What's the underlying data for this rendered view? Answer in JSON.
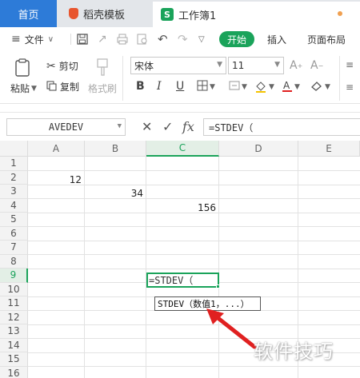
{
  "tabs": {
    "home": "首页",
    "daoke": "稻壳模板",
    "workbook": "工作簿1"
  },
  "menu": {
    "file": "文件",
    "start": "开始",
    "insert": "插入",
    "page_layout": "页面布局"
  },
  "ribbon": {
    "paste": "粘贴",
    "cut": "剪切",
    "copy": "复制",
    "format_painter": "格式刷",
    "font_name": "宋体",
    "font_size": "11"
  },
  "formula_bar": {
    "name_box": "AVEDEV",
    "formula": "=STDEV（"
  },
  "sheet": {
    "columns": [
      "A",
      "B",
      "C",
      "D",
      "E"
    ],
    "rows": [
      "1",
      "2",
      "3",
      "4",
      "5",
      "6",
      "7",
      "8",
      "9",
      "10",
      "11",
      "12",
      "13",
      "14",
      "15",
      "16"
    ],
    "cells": {
      "A2": "12",
      "B3": "34",
      "C4": "156",
      "C9": "=STDEV（"
    },
    "active_row": "9",
    "active_column": "C"
  },
  "tooltip": "STDEV（数值1，...）",
  "watermark": "软件技巧",
  "colors": {
    "tab_home": "#2d7bd8",
    "accent_green": "#1aa35a",
    "arrow_red": "#e02020"
  }
}
